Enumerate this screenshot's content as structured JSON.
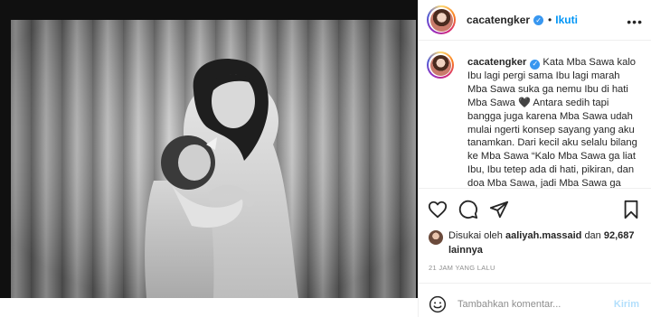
{
  "post": {
    "username": "cacatengker",
    "follow_label": "Ikuti",
    "header_separator": "•",
    "more_label": "•••",
    "verified_mark": "✓"
  },
  "caption": {
    "username": "cacatengker",
    "text": "Kata Mba Sawa kalo Ibu lagi pergi sama Ibu lagi marah Mba Sawa suka ga nemu Ibu di hati Mba Sawa 🖤 Antara sedih tapi bangga juga karena Mba Sawa udah mulai ngerti konsep sayang yang aku tanamkan. Dari kecil aku selalu bilang ke Mba Sawa “Kalo Mba Sawa ga liat Ibu, Ibu tetep ada di hati, pikiran, dan doa Mba Sawa, jadi Mba Sawa ga pernah sendirian” Ternyata itu nempel"
  },
  "likes": {
    "prefix": "Disukai oleh",
    "liker": "aaliyah.massaid",
    "connector": "dan",
    "others": "92,687 lainnya"
  },
  "timestamp": "21 JAM YANG LALU",
  "comment": {
    "placeholder": "Tambahkan komentar...",
    "post_label": "Kirim"
  },
  "icons": {
    "like": "heart-icon",
    "comment": "comment-icon",
    "share": "share-icon",
    "save": "bookmark-icon",
    "emoji": "emoji-icon",
    "more": "more-options-icon",
    "verified": "verified-badge-icon"
  },
  "colors": {
    "link": "#0095f6",
    "verified": "#3897f0",
    "muted": "#8e8e8e",
    "post_disabled": "#b2dffc",
    "divider": "#efefef"
  }
}
